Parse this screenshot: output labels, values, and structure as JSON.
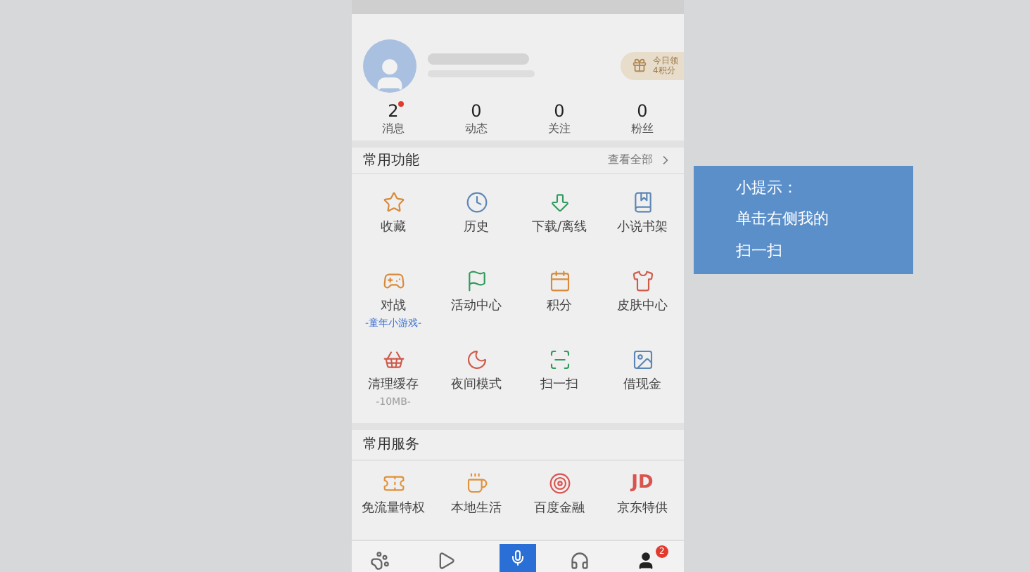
{
  "profile": {
    "reward": {
      "line1": "今日领",
      "line2": "4积分"
    }
  },
  "stats": [
    {
      "count": "2",
      "label": "消息",
      "dot": true
    },
    {
      "count": "0",
      "label": "动态",
      "dot": false
    },
    {
      "count": "0",
      "label": "关注",
      "dot": false
    },
    {
      "count": "0",
      "label": "粉丝",
      "dot": false
    }
  ],
  "functions": {
    "title": "常用功能",
    "more": "查看全部",
    "items": [
      {
        "label": "收藏"
      },
      {
        "label": "历史"
      },
      {
        "label": "下载/离线"
      },
      {
        "label": "小说书架"
      },
      {
        "label": "对战",
        "note": "-童年小游戏-",
        "kind": "link"
      },
      {
        "label": "活动中心"
      },
      {
        "label": "积分"
      },
      {
        "label": "皮肤中心"
      },
      {
        "label": "清理缓存",
        "note": "-10MB-",
        "kind": "muted"
      },
      {
        "label": "夜间模式"
      },
      {
        "label": "扫一扫"
      },
      {
        "label": "借现金"
      }
    ]
  },
  "services": {
    "title": "常用服务",
    "items": [
      {
        "label": "免流量特权"
      },
      {
        "label": "本地生活"
      },
      {
        "label": "百度金融"
      },
      {
        "label": "京东特供",
        "logo": "JD"
      }
    ]
  },
  "bottom_nav": [
    {
      "selected": false
    },
    {
      "selected": false
    },
    {
      "selected": false,
      "kind": "voice"
    },
    {
      "selected": false
    },
    {
      "selected": true,
      "badge": "2"
    }
  ],
  "tip": {
    "title": "小提示：",
    "lines": [
      "单击右侧我的",
      "扫一扫"
    ]
  }
}
